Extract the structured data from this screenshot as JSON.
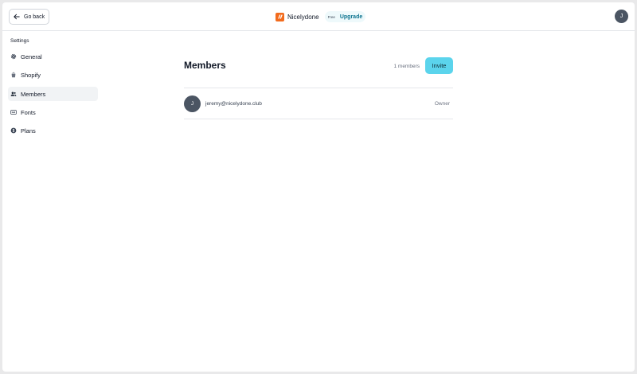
{
  "header": {
    "back_label": "Go back",
    "brand_name": "Nicelydone",
    "plan_label": "Free",
    "upgrade_label": "Upgrade",
    "user_initial": "J"
  },
  "sidebar": {
    "heading": "Settings",
    "items": [
      {
        "label": "General",
        "icon": "gear-icon",
        "active": false
      },
      {
        "label": "Shopify",
        "icon": "shopify-bag-icon",
        "active": false
      },
      {
        "label": "Members",
        "icon": "users-icon",
        "active": true
      },
      {
        "label": "Fonts",
        "icon": "fonts-icon",
        "active": false
      },
      {
        "label": "Plans",
        "icon": "dollar-circle-icon",
        "active": false
      }
    ]
  },
  "main": {
    "title": "Members",
    "member_count": "1 members",
    "invite_label": "Invite",
    "members": [
      {
        "initial": "J",
        "email": "jeremy@nicelydone.club",
        "role": "Owner"
      }
    ]
  },
  "colors": {
    "brand": "#f26b1d",
    "accent": "#5bd4ec",
    "upgrade": "#0e7490",
    "avatar": "#4b5563"
  }
}
